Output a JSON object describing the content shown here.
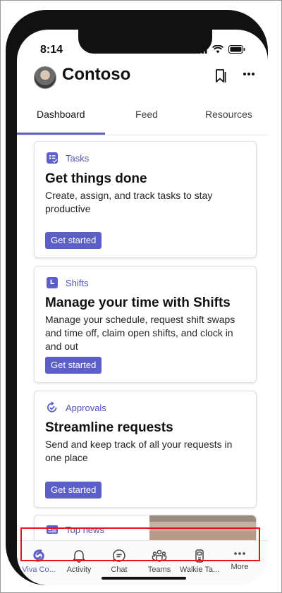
{
  "status_bar": {
    "time": "8:14"
  },
  "header": {
    "title": "Contoso"
  },
  "tabs": [
    {
      "label": "Dashboard"
    },
    {
      "label": "Feed"
    },
    {
      "label": "Resources"
    }
  ],
  "cards": [
    {
      "tag": "Tasks",
      "icon": "tasks-icon",
      "title": "Get things done",
      "description": "Create, assign, and track tasks to stay productive",
      "button": "Get started"
    },
    {
      "tag": "Shifts",
      "icon": "shifts-icon",
      "title": "Manage your time with Shifts",
      "description": "Manage your schedule, request shift swaps and time off, claim open shifts, and clock in and out",
      "button": "Get started"
    },
    {
      "tag": "Approvals",
      "icon": "approvals-icon",
      "title": "Streamline requests",
      "description": "Send and keep track of all your requests in one place",
      "button": "Get started"
    },
    {
      "tag": "Top news",
      "icon": "news-icon"
    }
  ],
  "bottom_nav": [
    {
      "label": "Viva Co...",
      "icon": "viva-connections-icon",
      "active": true
    },
    {
      "label": "Activity",
      "icon": "bell-icon"
    },
    {
      "label": "Chat",
      "icon": "chat-icon"
    },
    {
      "label": "Teams",
      "icon": "teams-icon"
    },
    {
      "label": "Walkie Ta...",
      "icon": "walkie-talkie-icon"
    },
    {
      "label": "More",
      "icon": "more-icon"
    }
  ],
  "colors": {
    "accent": "#5b5fc7",
    "highlight": "#e3141b"
  }
}
